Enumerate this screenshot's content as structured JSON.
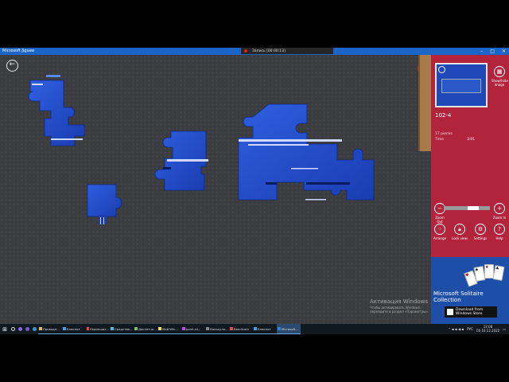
{
  "window": {
    "title": "Microsoft Jigsaw",
    "recorder_text": "Запись [00:00:13]"
  },
  "game": {
    "watermark_title": "Активация Windows",
    "watermark_sub": "Чтобы активировать Windows, перейдите в раздел «Параметры»."
  },
  "panel": {
    "puzzle_name": "102-4",
    "pieces_label": "17 pieces",
    "time_label": "Time",
    "time_value": "3:01",
    "buttons": {
      "show_image": "Show/hide image",
      "zoom_out": "Zoom Out",
      "zoom_in": "Zoom In",
      "arrange": "Arrange",
      "lock_view": "Lock view",
      "settings": "Settings",
      "help": "Help"
    },
    "zoom_level": 0.75
  },
  "ad": {
    "title": "Microsoft Solitaire Collection",
    "store_line1": "Download from",
    "store_line2": "Windows Store"
  },
  "taskbar": {
    "apps": [
      {
        "label": "Проводн...",
        "color": "#e8b84a"
      },
      {
        "label": "Блокнот",
        "color": "#4a9ee8"
      },
      {
        "label": "Скриншот...",
        "color": "#e84a4a"
      },
      {
        "label": "Средство...",
        "color": "#4ac0e8"
      },
      {
        "label": "Диспетче...",
        "color": "#7ac06a"
      },
      {
        "label": "Мой Win...",
        "color": "#e8e84a"
      },
      {
        "label": "point.rd...",
        "color": "#c04ae8"
      },
      {
        "label": "Калькуля...",
        "color": "#888888"
      },
      {
        "label": "Bandicam",
        "color": "#e84a4a"
      },
      {
        "label": "Блокнот",
        "color": "#4a9ee8"
      },
      {
        "label": "Microsoft...",
        "color": "#3a7ad8"
      }
    ],
    "lang": "РУС",
    "time": "12:08",
    "date": "Сб 10.12.2022"
  }
}
